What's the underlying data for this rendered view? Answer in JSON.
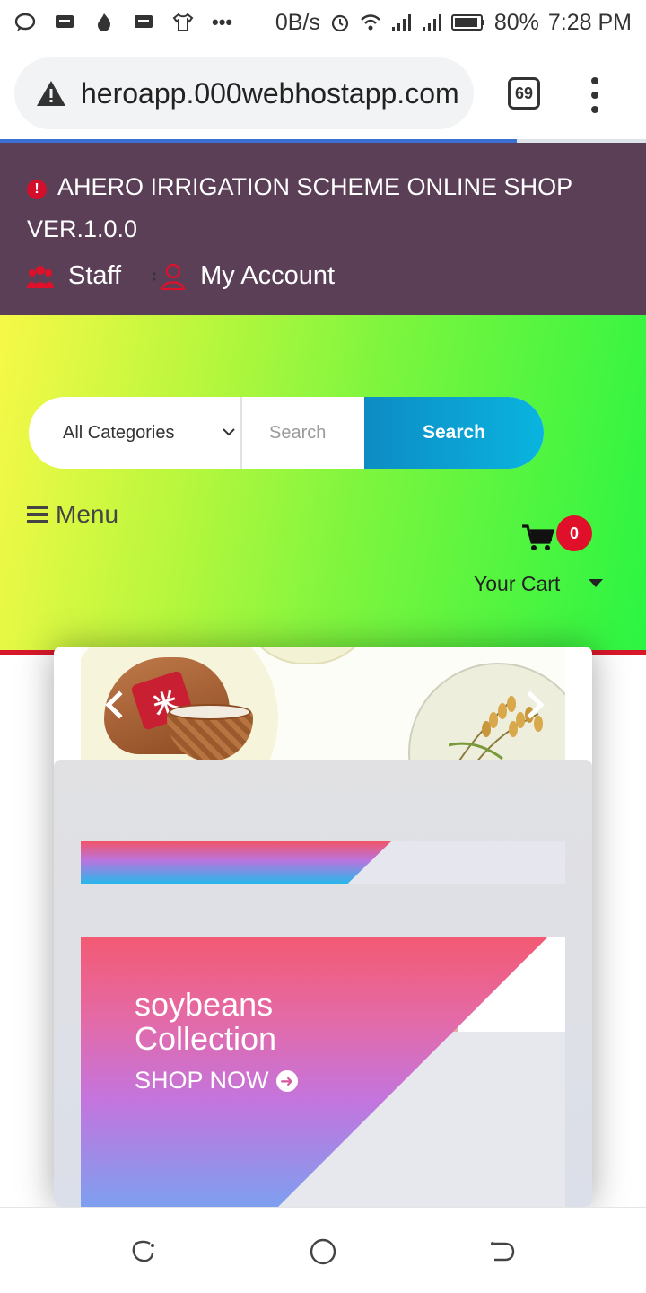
{
  "status_bar": {
    "net_speed": "0B/s",
    "battery": "80%",
    "time": "7:28 PM"
  },
  "browser": {
    "url": "heroapp.000webhostapp.com",
    "tab_count": "69"
  },
  "header": {
    "title_line1": "AHERO IRRIGATION SCHEME ONLINE SHOP",
    "title_line2": "VER.1.0.0",
    "staff_label": "Staff",
    "account_label": "My Account"
  },
  "search": {
    "category_selected": "All Categories",
    "placeholder": "Search",
    "button_label": "Search"
  },
  "nav": {
    "menu_label": "Menu"
  },
  "cart": {
    "count": "0",
    "label": "Your Cart"
  },
  "promo": {
    "line1": "soybeans",
    "line2": "Collection",
    "cta": "SHOP NOW"
  },
  "colors": {
    "header_bg": "#5b3f57",
    "accent_red": "#e0102b",
    "search_button": "#0ab4df"
  }
}
